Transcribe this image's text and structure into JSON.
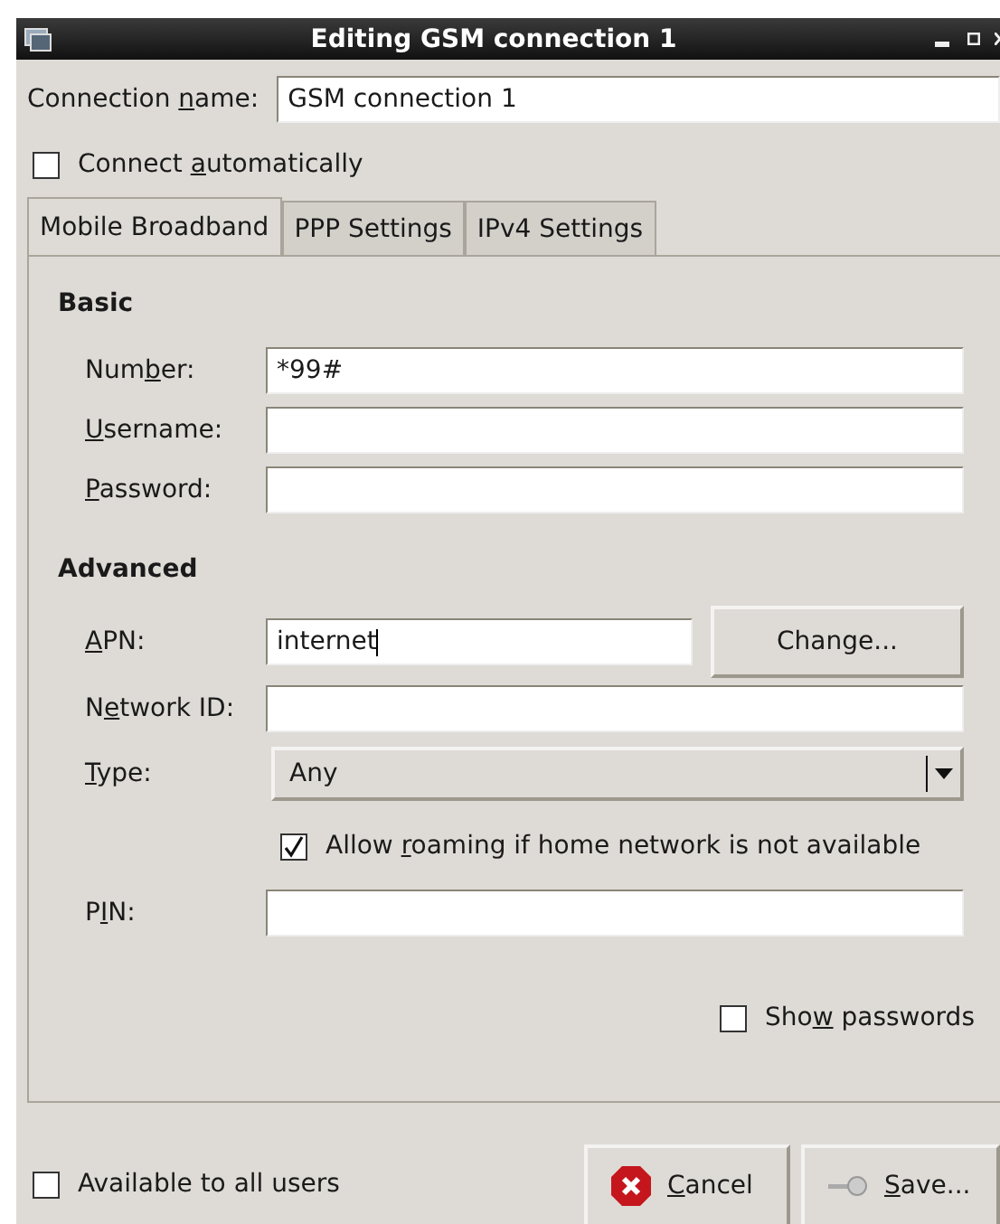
{
  "window": {
    "title": "Editing GSM connection 1"
  },
  "connection_name": {
    "label": {
      "pre": "Connection ",
      "key": "n",
      "post": "ame:"
    },
    "value": "GSM connection 1"
  },
  "connect_automatically": {
    "label": {
      "pre": "Connect ",
      "key": "a",
      "post": "utomatically"
    },
    "checked": false
  },
  "tabs": [
    {
      "label": "Mobile Broadband",
      "selected": true
    },
    {
      "label": "PPP Settings",
      "selected": false
    },
    {
      "label": "IPv4 Settings",
      "selected": false
    }
  ],
  "sections": [
    {
      "title": "Basic",
      "rows": [
        {
          "kind": "field",
          "label": {
            "pre": "Num",
            "key": "b",
            "post": "er:"
          },
          "value": "*99#"
        },
        {
          "kind": "field",
          "label": {
            "key": "U",
            "post": "sername:"
          }
        },
        {
          "kind": "field",
          "label": {
            "key": "P",
            "post": "assword:"
          }
        }
      ]
    },
    {
      "title": "Advanced",
      "rows": [
        {
          "kind": "field_button",
          "label": {
            "key": "A",
            "post": "PN:"
          },
          "value": "internet",
          "button": "Change..."
        },
        {
          "kind": "field",
          "label": {
            "pre": "N",
            "key": "e",
            "post": "twork ID:"
          }
        },
        {
          "kind": "combo",
          "label": {
            "key": "T",
            "post": "ype:"
          },
          "value": "Any"
        },
        {
          "kind": "check",
          "label": {
            "pre": "Allow ",
            "key": "r",
            "post": "oaming if home network is not available"
          },
          "checked": true
        },
        {
          "kind": "field",
          "label": {
            "pre": "P",
            "key": "I",
            "post": "N:"
          }
        }
      ]
    }
  ],
  "show_passwords": {
    "label": {
      "pre": "Sho",
      "key": "w",
      "post": " passwords"
    },
    "checked": false
  },
  "available_to_all_users": {
    "label": {
      "pre": "Available to all users"
    },
    "checked": false
  },
  "buttons": [
    {
      "kind": "cancel",
      "label": {
        "key": "C",
        "post": "ancel"
      }
    },
    {
      "kind": "save",
      "label": {
        "key": "S",
        "post": "ave..."
      }
    }
  ]
}
